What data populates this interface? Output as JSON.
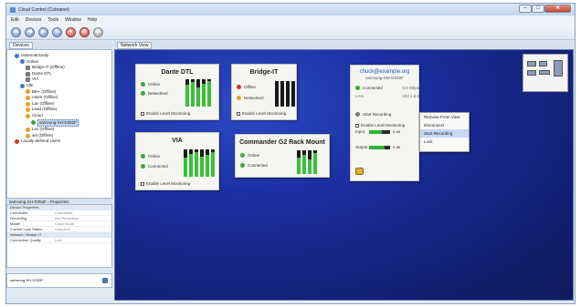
{
  "window": {
    "title": "Cloud Control (Cobranet)"
  },
  "menu": [
    "Edit",
    "Devices",
    "Tools",
    "Window",
    "Help"
  ],
  "toolbar": [
    "stop-icon",
    "back-icon",
    "forward-icon",
    "refresh-icon",
    "connect-icon",
    "disconnect-icon",
    "settings-icon"
  ],
  "left_panel": {
    "tab": "Devices",
    "tree": [
      {
        "label": "redwoodcloudy",
        "icon": "blue",
        "indent": 1
      },
      {
        "label": "Online",
        "icon": "blue",
        "indent": 2
      },
      {
        "label": "Bridge-IT (Offline)",
        "icon": "gray",
        "indent": 3
      },
      {
        "label": "Dante DTL",
        "icon": "gray",
        "indent": 3
      },
      {
        "label": "VIA",
        "icon": "gray",
        "indent": 3
      },
      {
        "label": "Idle",
        "icon": "blue",
        "indent": 2
      },
      {
        "label": "Bln+ (Offline)",
        "icon": "orange",
        "indent": 3
      },
      {
        "label": "Aslen (Offline)",
        "icon": "orange",
        "indent": 3
      },
      {
        "label": "Lav (Offline)",
        "icon": "orange",
        "indent": 3
      },
      {
        "label": "Lead (Offline)",
        "icon": "orange",
        "indent": 3
      },
      {
        "label": "Cloud",
        "icon": "orange",
        "indent": 3
      },
      {
        "label": "samsung-SH-D353F",
        "icon": "green",
        "indent": 4,
        "selected": true
      },
      {
        "label": "Lev (Offline)",
        "icon": "orange",
        "indent": 3
      },
      {
        "label": "set (Offline)",
        "icon": "orange",
        "indent": 3
      },
      {
        "label": "Locally-defined Users",
        "icon": "red",
        "indent": 1
      }
    ]
  },
  "properties": {
    "tab": "samsung-SH-D353F - Properties",
    "section_device": "Device Properties",
    "rows": [
      {
        "k": "Connected",
        "v": "Connected"
      },
      {
        "k": "Recording",
        "v": "Not Recording"
      },
      {
        "k": "Model",
        "v": "Cloud Node"
      },
      {
        "k": "Current Lock Status",
        "v": "Unlocked"
      }
    ],
    "section_network": "Network / Bridge-IT",
    "rows2": [
      {
        "k": "Connection Quality",
        "v": "Low"
      }
    ]
  },
  "status": {
    "text": "samsung-SH-D353F"
  },
  "canvas_tab": "Network View",
  "devices": [
    {
      "name": "Dante DTL",
      "status1": "Online",
      "status2": "Networked",
      "footer": "Enable Level Monitoring",
      "levels": [
        0.8,
        0.9,
        0.7,
        0.85,
        0.95
      ]
    },
    {
      "name": "Bridge-IT",
      "status1": "Offline",
      "status2": "Networked",
      "footer": "Enable Level Monitoring",
      "levels": [
        0,
        0,
        0,
        0
      ]
    },
    {
      "name": "VIA",
      "status1": "Online",
      "status2": "Connected",
      "footer": "Enable Level Monitoring",
      "levels": [
        0.7,
        0.85,
        0.9,
        0.75,
        0.8,
        0.9
      ]
    },
    {
      "name": "Commander G2 Rack Mount",
      "status1": "Online",
      "status2": "Connected",
      "footer": "",
      "levels": [
        0.7,
        0.8,
        0.6,
        0.9
      ]
    }
  ],
  "user_card": {
    "email": "chuck@example.org",
    "device": "samsung-SM-G930F",
    "status": "Connected",
    "status_value": "0.9 Mbps",
    "row2": "LAN",
    "row2_value": "192.1.8.5",
    "recording_label": "Start Recording",
    "monitor_label": "Enable Level Monitoring",
    "input_label": "Input",
    "input_value": "0 dB",
    "output_label": "Output",
    "output_value": "0 dB",
    "input_level": 0.6,
    "output_level": 0.75
  },
  "context_menu": [
    "Remove From View",
    "Disconnect",
    "Start Recording",
    "Lock"
  ]
}
